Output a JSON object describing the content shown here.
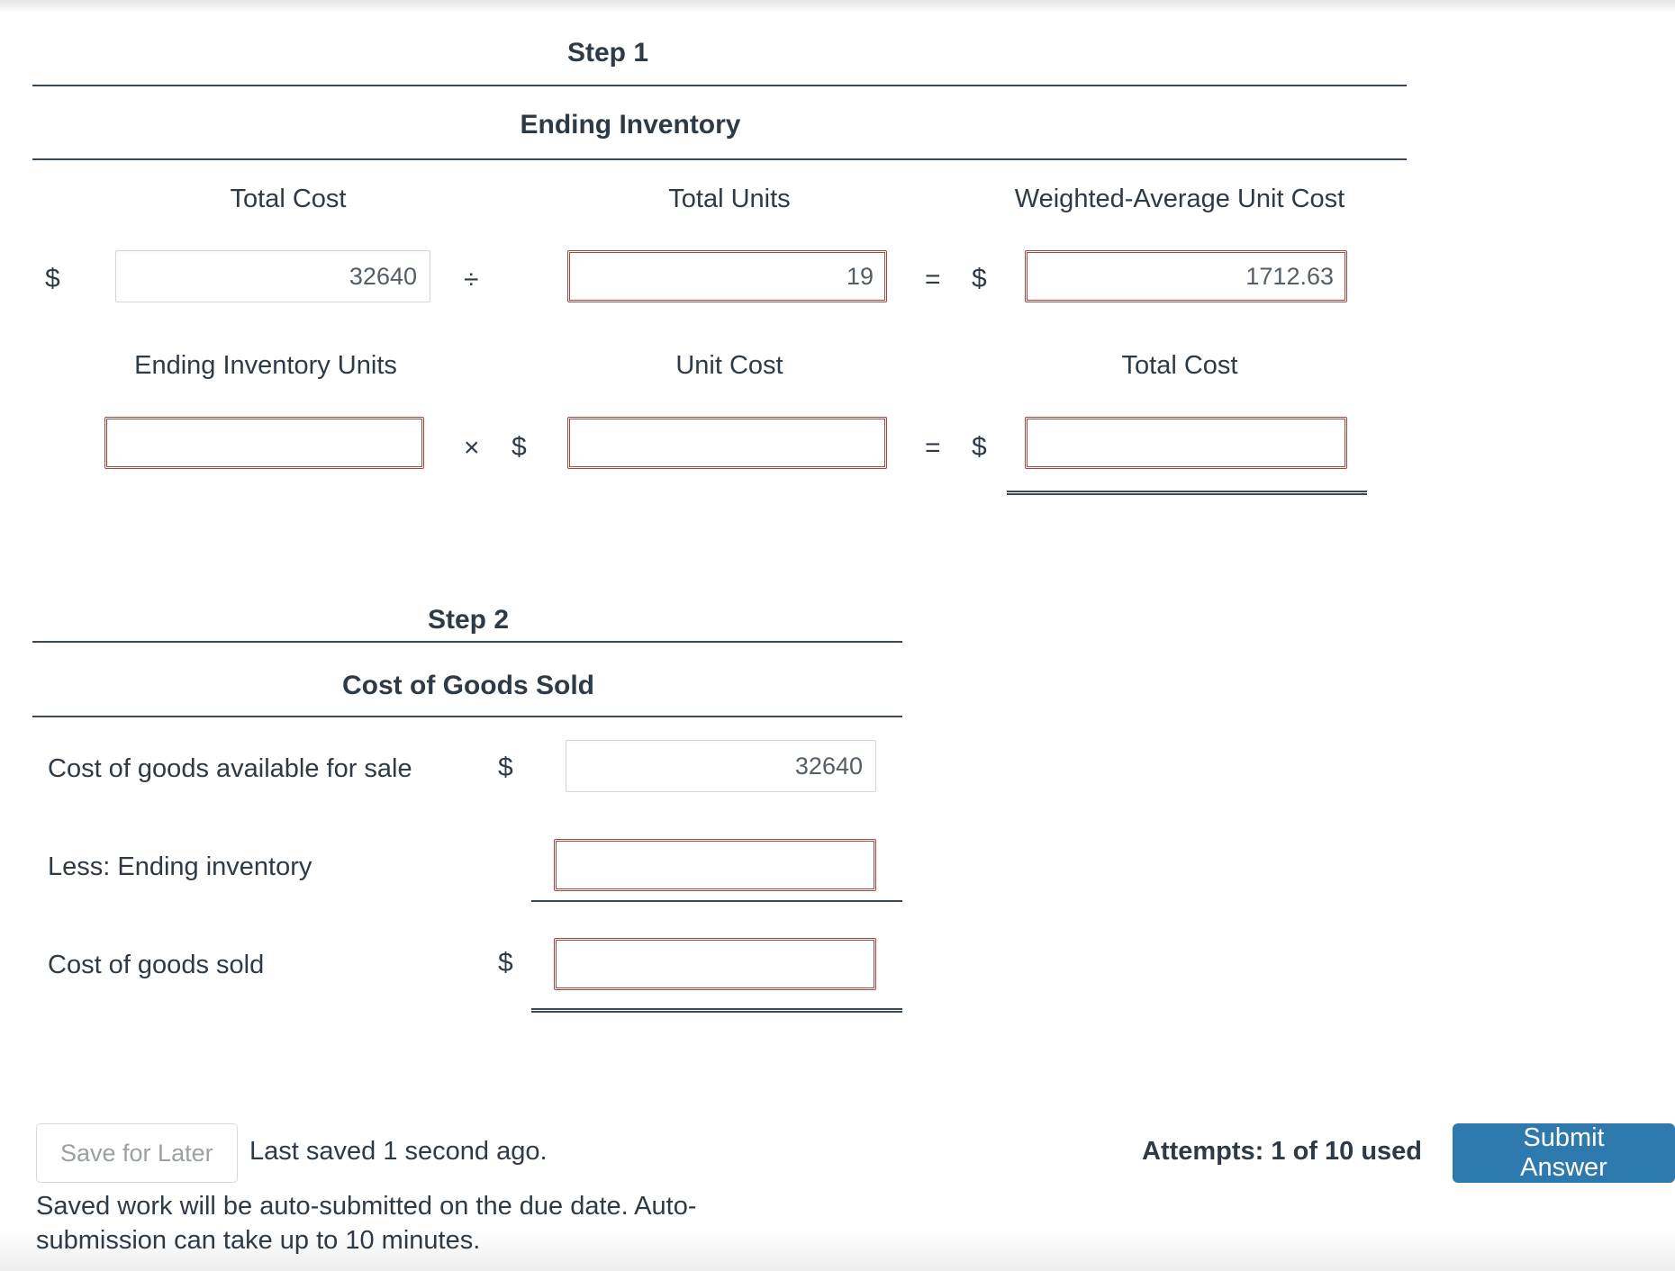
{
  "step1": {
    "step_label": "Step 1",
    "section_title": "Ending Inventory",
    "row1": {
      "col1_label": "Total Cost",
      "col2_label": "Total Units",
      "col3_label": "Weighted-Average Unit Cost",
      "currency_symbol_1": "$",
      "total_cost_value": "32640",
      "operator_divide": "÷",
      "total_units_value": "19",
      "operator_equals": "=",
      "currency_symbol_2": "$",
      "weighted_average_unit_cost_value": "1712.63"
    },
    "row2": {
      "col1_label": "Ending Inventory Units",
      "col2_label": "Unit Cost",
      "col3_label": "Total Cost",
      "ending_inventory_units_value": "",
      "operator_multiply": "×",
      "currency_symbol_1": "$",
      "unit_cost_value": "",
      "operator_equals": "=",
      "currency_symbol_2": "$",
      "total_cost_value": ""
    }
  },
  "step2": {
    "step_label": "Step 2",
    "section_title": "Cost of Goods Sold",
    "rows": [
      {
        "label": "Cost of goods available for sale",
        "currency_symbol": "$",
        "value": "32640"
      },
      {
        "label": "Less: Ending inventory",
        "currency_symbol": "",
        "value": ""
      },
      {
        "label": "Cost of goods sold",
        "currency_symbol": "$",
        "value": ""
      }
    ]
  },
  "footer": {
    "save_label": "Save for Later",
    "saved_status": "Last saved 1 second ago.",
    "auto_note": "Saved work will be auto-submitted on the due date. Auto-submission can take up to 10 minutes.",
    "attempts": "Attempts: 1 of 10 used",
    "submit_label": "Submit Answer"
  },
  "colors": {
    "error_border": "#9d4843",
    "submit_blue": "#2e7aae",
    "text": "#2e3a46",
    "rule": "#3d4852"
  }
}
